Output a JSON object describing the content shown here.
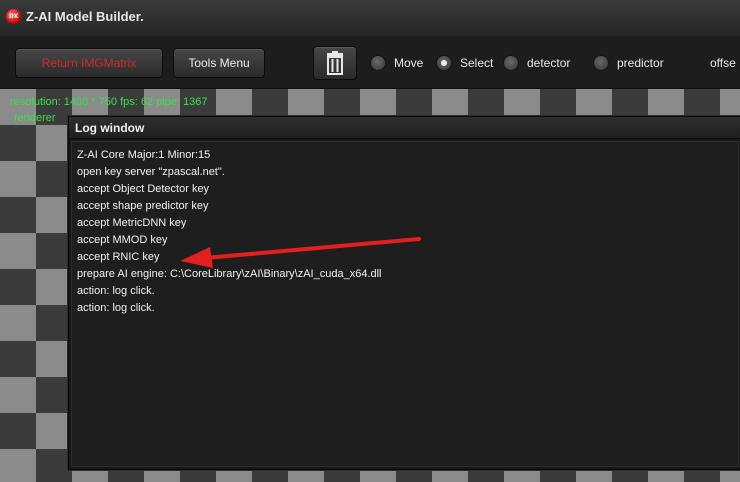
{
  "window": {
    "title": "Z-AI Model Builder.",
    "icon_name": "app-logo-icon",
    "icon_text": "DX"
  },
  "toolbar": {
    "return_label": "Return IMGMatrix",
    "tools_label": "Tools Menu",
    "trash_icon": "trash-icon",
    "modes": [
      {
        "label": "Move",
        "checked": false
      },
      {
        "label": "Select",
        "checked": true
      },
      {
        "label": "detector",
        "checked": false
      },
      {
        "label": "predictor",
        "checked": false
      }
    ],
    "overflow_label": "offse"
  },
  "status": {
    "line1": "resolution: 1408 * 750 fps: 62 pipe: 1367",
    "line2": "renderer"
  },
  "log_window": {
    "title": "Log window",
    "lines": [
      "Z-AI Core Major:1 Minor:15",
      "open key server \"zpascal.net\".",
      "accept Object Detector key",
      "accept shape predictor key",
      "accept MetricDNN key",
      "accept MMOD key",
      "accept RNIC key",
      "prepare AI engine: C:\\CoreLibrary\\zAI\\Binary\\zAI_cuda_x64.dll",
      "action: log click.",
      "action: log click."
    ]
  },
  "annotation": {
    "type": "red-arrow",
    "color": "#e32020",
    "points_to_line_index": 6
  },
  "colors": {
    "accent_red": "#cc2b2b",
    "status_green": "#3be04a",
    "checker_dark": "#3b3b3b",
    "checker_light": "#8b8b8b"
  }
}
